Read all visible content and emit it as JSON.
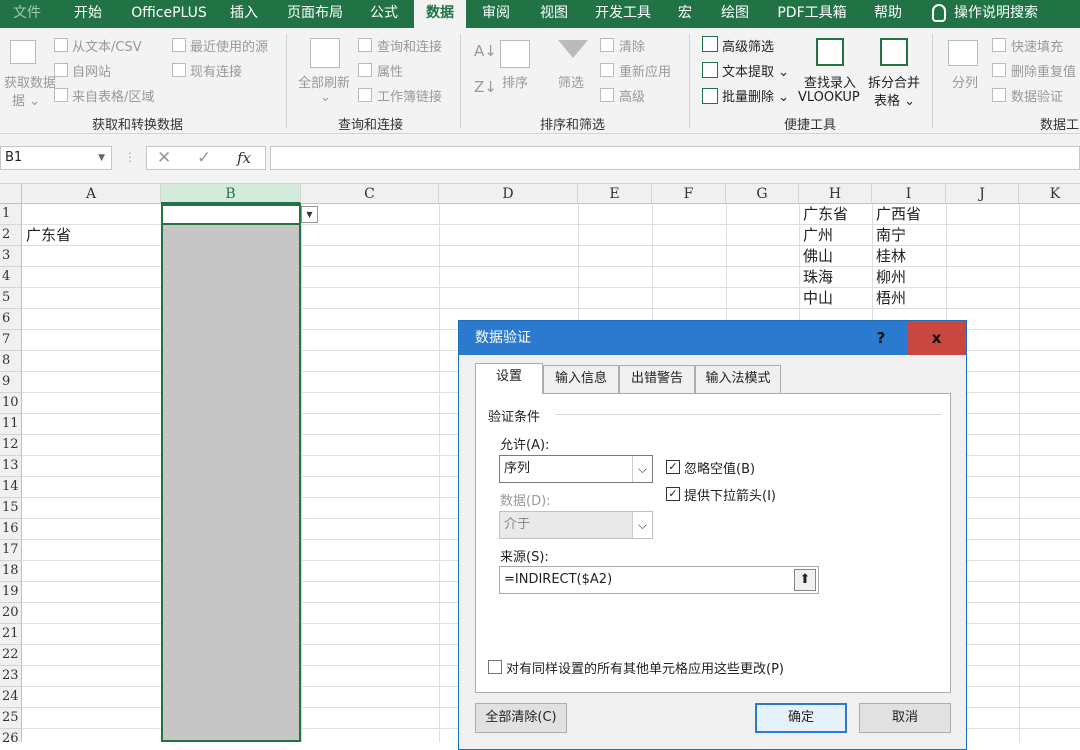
{
  "ribbon_tabs": [
    "文件",
    "开始",
    "OfficePLUS",
    "插入",
    "页面布局",
    "公式",
    "数据",
    "审阅",
    "视图",
    "开发工具",
    "宏",
    "绘图",
    "PDF工具箱",
    "帮助",
    "操作说明搜索"
  ],
  "ribbon": {
    "get_data": {
      "big_label": "获取数据",
      "big_label2": "据",
      "items": [
        "从文本/CSV",
        "自网站",
        "来自表格/区域",
        "最近使用的源",
        "现有连接"
      ],
      "group": "获取和转换数据"
    },
    "queries": {
      "big_label": "全部刷新",
      "items": [
        "查询和连接",
        "属性",
        "工作簿链接"
      ],
      "group": "查询和连接"
    },
    "sort": {
      "sort_label": "排序",
      "filter_label": "筛选",
      "items": [
        "清除",
        "重新应用",
        "高级"
      ],
      "group": "排序和筛选"
    },
    "quick": {
      "items": [
        "高级筛选",
        "文本提取",
        "批量删除"
      ],
      "lookup_line1": "查找录入",
      "lookup_line2": "VLOOKUP",
      "split_line1": "拆分合并",
      "split_line2": "表格",
      "group": "便捷工具"
    },
    "data_tools": {
      "big_label": "分列",
      "items": [
        "快速填充",
        "删除重复值",
        "数据验证"
      ],
      "group": "数据工"
    }
  },
  "formula_bar": {
    "name_box": "B1",
    "fx": "fx",
    "formula": ""
  },
  "sheet": {
    "columns": [
      "A",
      "B",
      "C",
      "D",
      "E",
      "F",
      "G",
      "H",
      "I",
      "J",
      "K"
    ],
    "rows": [
      "1",
      "2",
      "3",
      "4",
      "5",
      "6",
      "7",
      "8",
      "9",
      "10",
      "11",
      "12",
      "13",
      "14",
      "15",
      "16",
      "17",
      "18",
      "19",
      "20",
      "21",
      "22",
      "23",
      "24",
      "25",
      "26"
    ],
    "a2": "广东省",
    "h": [
      "广东省",
      "广州",
      "佛山",
      "珠海",
      "中山"
    ],
    "i": [
      "广西省",
      "南宁",
      "桂林",
      "柳州",
      "梧州"
    ]
  },
  "dialog": {
    "title": "数据验证",
    "help": "?",
    "close": "x",
    "tabs": [
      "设置",
      "输入信息",
      "出错警告",
      "输入法模式"
    ],
    "section": "验证条件",
    "allow_label": "允许(A):",
    "allow_value": "序列",
    "ignore_blank": "忽略空值(B)",
    "dropdown": "提供下拉箭头(I)",
    "data_label": "数据(D):",
    "data_value": "介于",
    "source_label": "来源(S):",
    "source_value": "=INDIRECT($A2)",
    "apply_all": "对有同样设置的所有其他单元格应用这些更改(P)",
    "clear_all": "全部清除(C)",
    "ok": "确定",
    "cancel": "取消",
    "checked": {
      "ignore_blank": true,
      "dropdown": true,
      "apply_all": false
    }
  }
}
